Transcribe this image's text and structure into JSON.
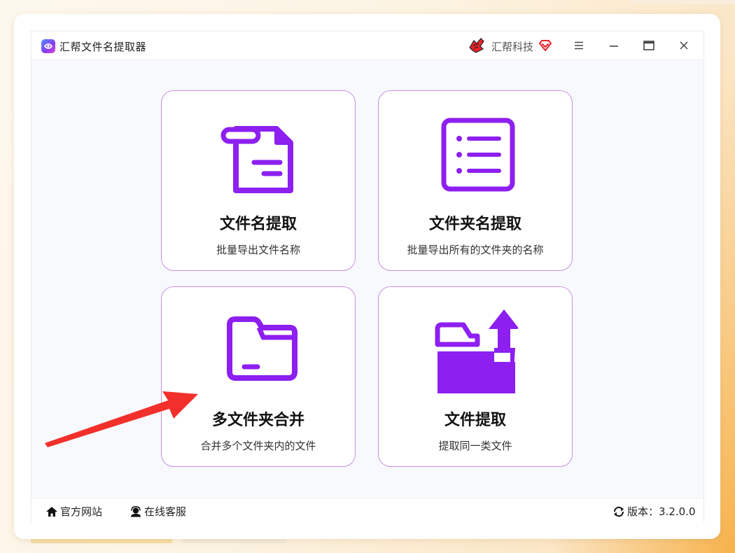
{
  "app": {
    "title": "汇帮文件名提取器",
    "brand": "汇帮科技"
  },
  "titlebar_icons": [
    "menu-icon",
    "minimize-icon",
    "maximize-icon",
    "close-icon"
  ],
  "cards": [
    {
      "title": "文件名提取",
      "description": "批量导出文件名称",
      "icon": "file-icon"
    },
    {
      "title": "文件夹名提取",
      "description": "批量导出所有的文件夹的名称",
      "icon": "list-icon"
    },
    {
      "title": "多文件夹合并",
      "description": "合并多个文件夹内的文件",
      "icon": "folder-icon"
    },
    {
      "title": "文件提取",
      "description": "提取同一类文件",
      "icon": "folder-upload-icon"
    }
  ],
  "footer": {
    "official_site": "官方网站",
    "online_service": "在线客服",
    "version_label": "版本：",
    "version": "3.2.0.0"
  },
  "colors": {
    "accent": "#8d1ff0",
    "card_border": "#c98fe0",
    "annotation_arrow": "#f2302b"
  }
}
